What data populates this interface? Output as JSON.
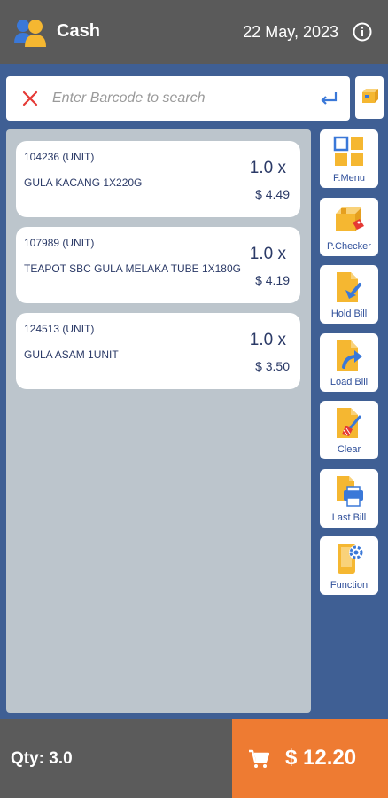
{
  "header": {
    "title": "Cash",
    "date": "22 May, 2023",
    "user_icon": "users-icon",
    "info_icon": "info-icon"
  },
  "search": {
    "placeholder": "Enter Barcode to search",
    "value": "",
    "clear_icon": "close-icon",
    "enter_icon": "enter-arrow-icon",
    "scan_icon": "package-scan-icon"
  },
  "items": [
    {
      "code": "104236 (UNIT)",
      "description": "GULA KACANG 1X220G",
      "qty": "1.0 x",
      "price": "$ 4.49"
    },
    {
      "code": "107989 (UNIT)",
      "description": "TEAPOT SBC GULA MELAKA TUBE 1X180G",
      "qty": "1.0 x",
      "price": "$ 4.19"
    },
    {
      "code": "124513 (UNIT)",
      "description": "GULA ASAM 1UNIT",
      "qty": "1.0 x",
      "price": "$ 3.50"
    }
  ],
  "side_buttons": [
    {
      "label": "F.Menu",
      "icon": "grid-menu-icon"
    },
    {
      "label": "P.Checker",
      "icon": "price-tag-box-icon"
    },
    {
      "label": "Hold Bill",
      "icon": "hold-bill-icon"
    },
    {
      "label": "Load Bill",
      "icon": "load-bill-icon"
    },
    {
      "label": "Clear",
      "icon": "clear-bill-icon"
    },
    {
      "label": "Last Bill",
      "icon": "printer-icon"
    },
    {
      "label": "Function",
      "icon": "settings-phone-icon"
    }
  ],
  "footer": {
    "qty": "Qty: 3.0",
    "total": "$ 12.20",
    "cart_icon": "cart-icon"
  },
  "colors": {
    "background": "#3f5f94",
    "header": "#5a5a5a",
    "accent": "#ee7b32",
    "text_primary": "#2b3a67",
    "icon_yellow": "#f5b731",
    "icon_blue": "#3a78d8"
  }
}
